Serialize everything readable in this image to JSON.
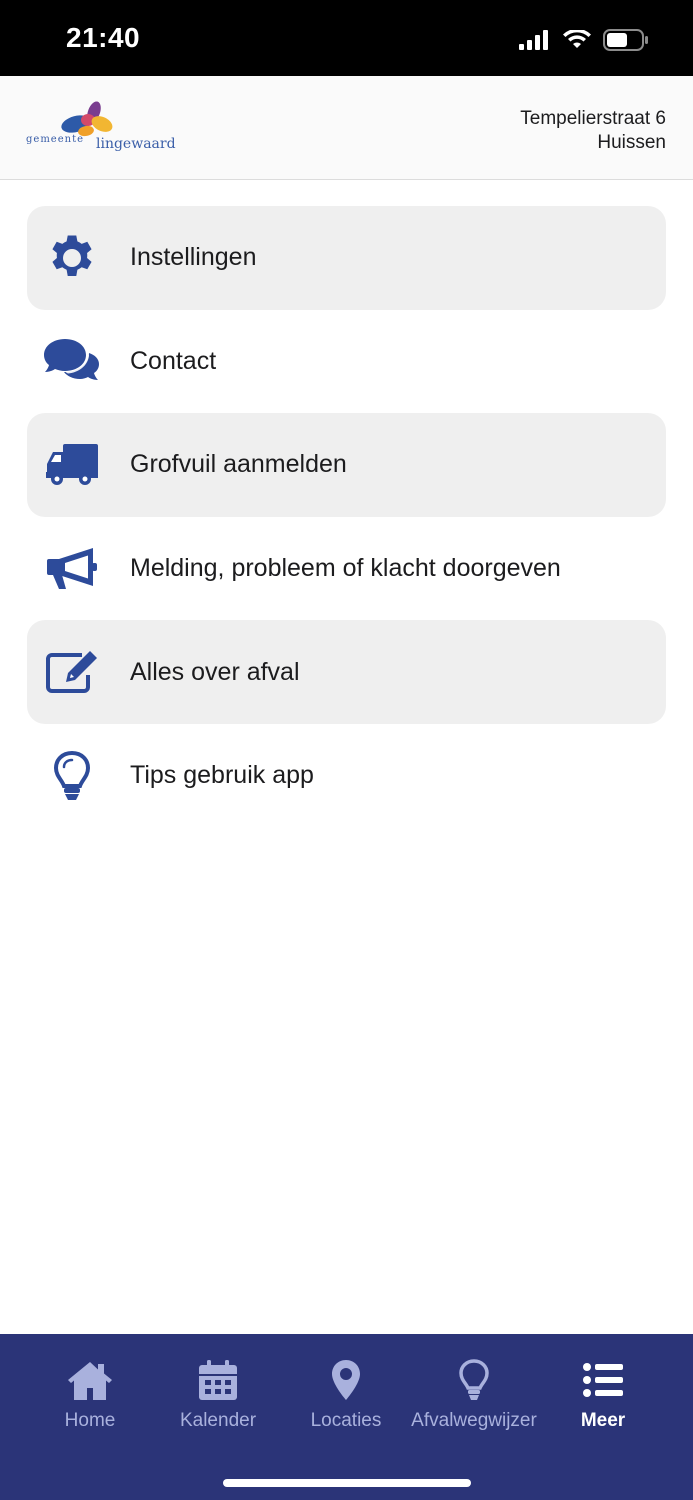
{
  "status_bar": {
    "time": "21:40"
  },
  "header": {
    "logo_small": "gemeente",
    "logo_big": "lingewaard",
    "address_line1": "Tempelierstraat 6",
    "address_line2": "Huissen"
  },
  "menu": {
    "items": [
      {
        "label": "Instellingen",
        "icon": "gear-icon"
      },
      {
        "label": "Contact",
        "icon": "chat-bubbles-icon"
      },
      {
        "label": "Grofvuil aanmelden",
        "icon": "truck-icon"
      },
      {
        "label": "Melding, probleem of klacht doorgeven",
        "icon": "megaphone-icon"
      },
      {
        "label": "Alles over afval",
        "icon": "edit-icon"
      },
      {
        "label": "Tips gebruik app",
        "icon": "lightbulb-icon"
      }
    ]
  },
  "tabs": [
    {
      "label": "Home",
      "icon": "home-icon"
    },
    {
      "label": "Kalender",
      "icon": "calendar-icon"
    },
    {
      "label": "Locaties",
      "icon": "map-pin-icon"
    },
    {
      "label": "Afvalwegwijzer",
      "icon": "lightbulb-icon"
    },
    {
      "label": "Meer",
      "icon": "list-icon",
      "active": true
    }
  ],
  "colors": {
    "primary": "#2b3478",
    "icon_blue": "#2d4b9a",
    "tab_inactive": "#a9b1dd",
    "row_shade": "#efefef"
  }
}
